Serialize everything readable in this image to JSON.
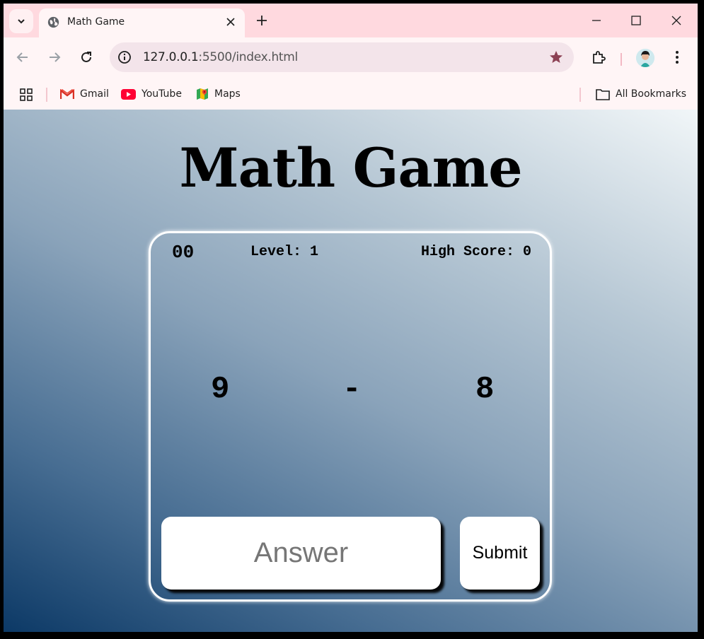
{
  "browser": {
    "tab_title": "Math Game",
    "url_host": "127.0.0.1",
    "url_path": ":5500/index.html",
    "bookmarks": [
      {
        "label": "Gmail",
        "icon": "gmail-icon"
      },
      {
        "label": "YouTube",
        "icon": "youtube-icon"
      },
      {
        "label": "Maps",
        "icon": "maps-icon"
      }
    ],
    "all_bookmarks_label": "All Bookmarks"
  },
  "game": {
    "title": "Math Game",
    "timer": "00",
    "level": "Level: 1",
    "high_score": "High Score: 0",
    "operand_left": "9",
    "operator": "-",
    "operand_right": "8",
    "answer_placeholder": "Answer",
    "submit_label": "Submit"
  },
  "colors": {
    "tab_strip": "#ffd9df",
    "toolbar": "#fff5f6",
    "gradient_dark": "#0c3966",
    "gradient_light": "#f1f6f8"
  }
}
